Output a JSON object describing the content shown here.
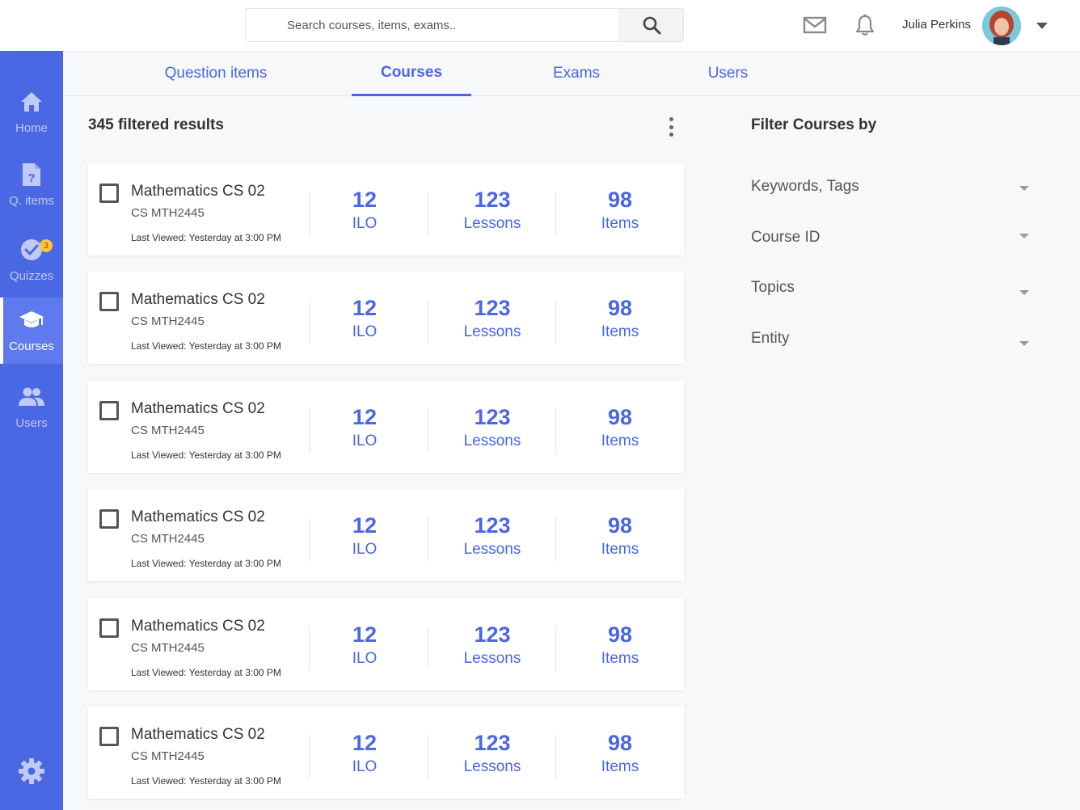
{
  "search": {
    "placeholder": "Search courses, items, exams.."
  },
  "user": {
    "name": "Julia Perkins"
  },
  "sidebar": {
    "items": [
      {
        "label": "Home"
      },
      {
        "label": "Q. items"
      },
      {
        "label": "Quizzes",
        "badge": "3"
      },
      {
        "label": "Courses"
      },
      {
        "label": "Users"
      }
    ],
    "active": "Courses"
  },
  "tabs": [
    {
      "label": "Question items"
    },
    {
      "label": "Courses"
    },
    {
      "label": "Exams"
    },
    {
      "label": "Users"
    }
  ],
  "results": {
    "count_text": "345 filtered results"
  },
  "courses": [
    {
      "title": "Mathematics CS 02",
      "code": "CS MTH2445",
      "last_viewed": "Last Viewed: Yesterday at 3:00 PM",
      "ilo": "12",
      "ilo_label": "ILO",
      "lessons": "123",
      "lessons_label": "Lessons",
      "items": "98",
      "items_label": "Items"
    },
    {
      "title": "Mathematics CS 02",
      "code": "CS MTH2445",
      "last_viewed": "Last Viewed: Yesterday at 3:00 PM",
      "ilo": "12",
      "ilo_label": "ILO",
      "lessons": "123",
      "lessons_label": "Lessons",
      "items": "98",
      "items_label": "Items"
    },
    {
      "title": "Mathematics CS 02",
      "code": "CS MTH2445",
      "last_viewed": "Last Viewed: Yesterday at 3:00 PM",
      "ilo": "12",
      "ilo_label": "ILO",
      "lessons": "123",
      "lessons_label": "Lessons",
      "items": "98",
      "items_label": "Items"
    },
    {
      "title": "Mathematics CS 02",
      "code": "CS MTH2445",
      "last_viewed": "Last Viewed: Yesterday at 3:00 PM",
      "ilo": "12",
      "ilo_label": "ILO",
      "lessons": "123",
      "lessons_label": "Lessons",
      "items": "98",
      "items_label": "Items"
    },
    {
      "title": "Mathematics CS 02",
      "code": "CS MTH2445",
      "last_viewed": "Last Viewed: Yesterday at 3:00 PM",
      "ilo": "12",
      "ilo_label": "ILO",
      "lessons": "123",
      "lessons_label": "Lessons",
      "items": "98",
      "items_label": "Items"
    },
    {
      "title": "Mathematics CS 02",
      "code": "CS MTH2445",
      "last_viewed": "Last Viewed: Yesterday at 3:00 PM",
      "ilo": "12",
      "ilo_label": "ILO",
      "lessons": "123",
      "lessons_label": "Lessons",
      "items": "98",
      "items_label": "Items"
    }
  ],
  "filters": {
    "title": "Filter Courses by",
    "items": [
      {
        "label": "Keywords, Tags"
      },
      {
        "label": "Course ID"
      },
      {
        "label": "Topics"
      },
      {
        "label": "Entity"
      }
    ]
  },
  "icons": {
    "search": "search-icon",
    "mail": "mail-icon",
    "bell": "bell-icon",
    "home": "home-icon",
    "q_items": "question-document-icon",
    "quizzes": "check-circle-icon",
    "courses": "graduation-cap-icon",
    "users": "users-icon",
    "settings": "gear-icon",
    "more": "vertical-dots-icon"
  },
  "colors": {
    "primary": "#4a67e4",
    "sidebar_active": "#5e7aee",
    "badge": "#fdc53a",
    "background": "#f7f8fa"
  }
}
